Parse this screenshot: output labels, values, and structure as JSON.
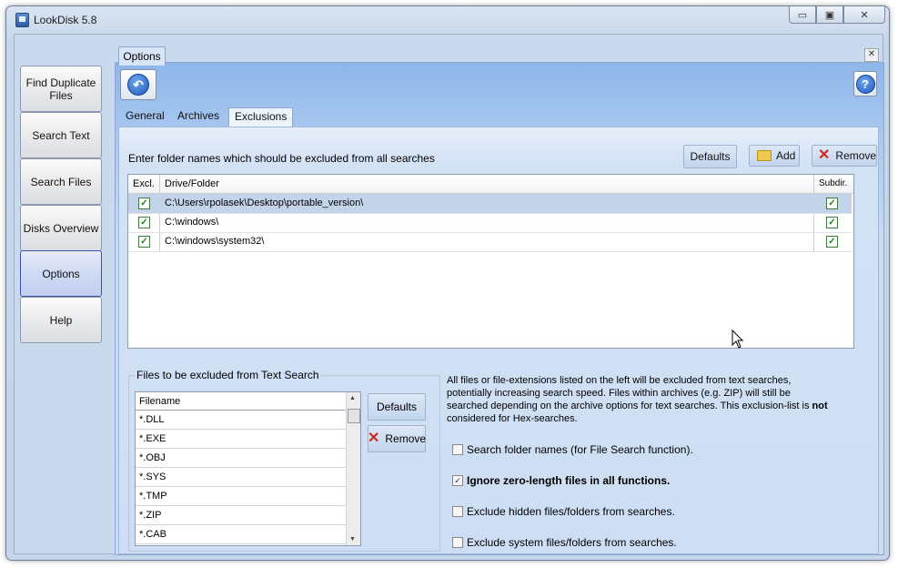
{
  "window": {
    "title": "LookDisk 5.8",
    "caption": {
      "minimize": "▭",
      "maximize": "▣",
      "close": "✕"
    }
  },
  "nav": [
    {
      "line1": "Find Duplicate",
      "line2": "Files"
    },
    {
      "line1": "Search Text",
      "line2": ""
    },
    {
      "line1": "Search Files",
      "line2": ""
    },
    {
      "line1": "Disks Overview",
      "line2": ""
    },
    {
      "line1": "Options",
      "line2": ""
    },
    {
      "line1": "Help",
      "line2": ""
    }
  ],
  "panel": {
    "tab_label": "Options",
    "close_glyph": "✕",
    "back_glyph": "↶",
    "help_glyph": "?",
    "subtabs": [
      "General",
      "Archives",
      "Exclusions"
    ]
  },
  "exclusions": {
    "intro": "Enter folder names which should be excluded from all searches",
    "defaults_label": "Defaults",
    "add_label": "Add",
    "remove_label": "Remove",
    "columns": {
      "excl": "Excl.",
      "folder": "Drive/Folder",
      "subdir": "Subdir."
    },
    "rows": [
      {
        "path": "C:\\Users\\rpolasek\\Desktop\\portable_version\\",
        "excl": true,
        "subdir": true
      },
      {
        "path": "C:\\windows\\",
        "excl": true,
        "subdir": true
      },
      {
        "path": "C:\\windows\\system32\\",
        "excl": true,
        "subdir": true
      }
    ],
    "check_glyph": "✓"
  },
  "text_exclusions": {
    "group_title": "Files to be excluded from Text Search",
    "column": "Filename",
    "files": [
      "*.DLL",
      "*.EXE",
      "*.OBJ",
      "*.SYS",
      "*.TMP",
      "*.ZIP",
      "*.CAB"
    ],
    "defaults_label": "Defaults",
    "remove_label": "Remove"
  },
  "info": {
    "text_a": "All files or file-extensions listed on the left will be excluded from text searches, potentially increasing search speed. Files within archives (e.g. ZIP) will still be searched depending on the archive options for text searches. This exclusion-list is ",
    "text_bold": "not",
    "text_b": " considered for Hex-searches."
  },
  "options": [
    {
      "label": "Search folder names (for File Search function).",
      "checked": false,
      "bold": false
    },
    {
      "label": "Ignore zero-length files in all functions.",
      "checked": true,
      "bold": true
    },
    {
      "label": "Exclude hidden files/folders from searches.",
      "checked": false,
      "bold": false
    },
    {
      "label": "Exclude system files/folders from searches.",
      "checked": false,
      "bold": false
    }
  ],
  "colors": {
    "accent": "#1d59c2",
    "selected_row": "#c3d3ea",
    "remove_icon": "#d0281f"
  }
}
